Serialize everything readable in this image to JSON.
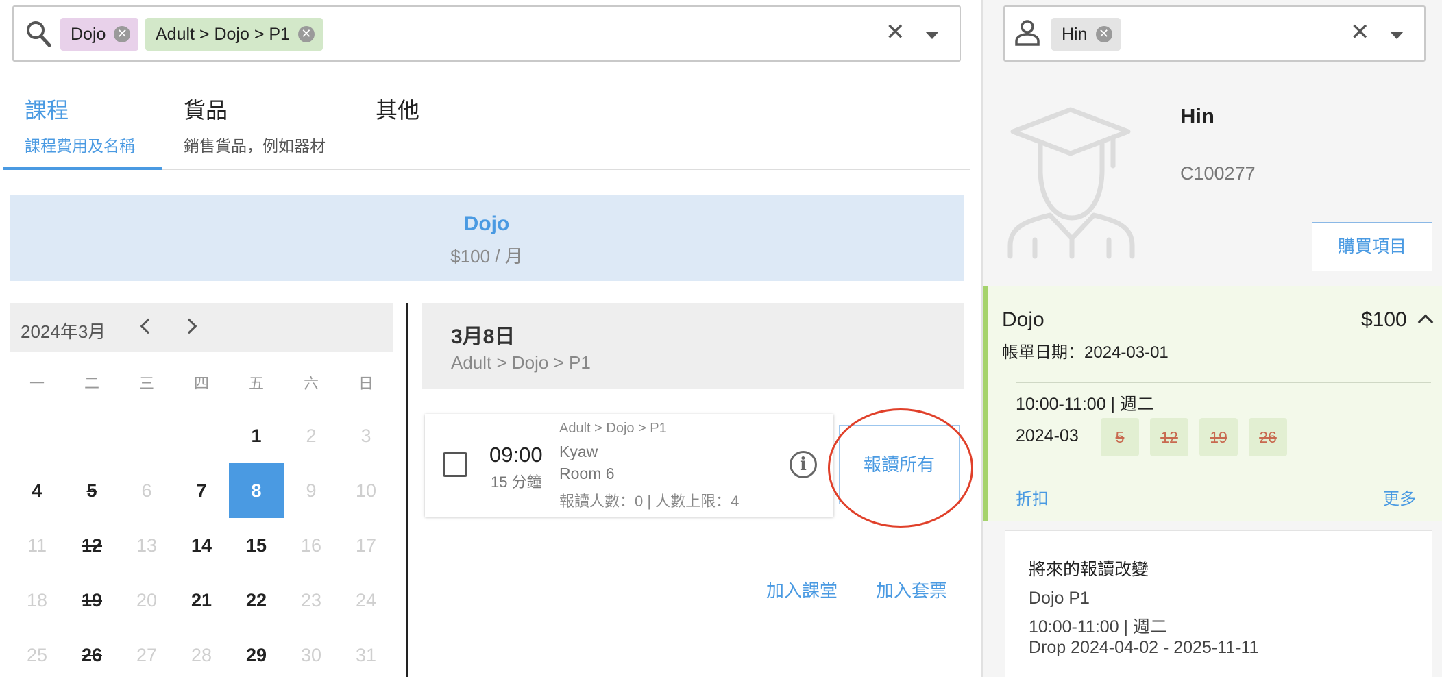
{
  "course_search": {
    "chips": [
      {
        "label": "Dojo"
      },
      {
        "label": "Adult > Dojo > P1"
      }
    ]
  },
  "tabs": [
    {
      "title": "課程",
      "subtitle": "課程費用及名稱",
      "active": true
    },
    {
      "title": "貨品",
      "subtitle": "銷售貨品，例如器材",
      "active": false
    },
    {
      "title": "其他",
      "subtitle": "",
      "active": false
    }
  ],
  "course_banner": {
    "name": "Dojo",
    "price": "$100 / 月"
  },
  "calendar": {
    "month_label": "2024年3月",
    "weekdays": [
      "一",
      "二",
      "三",
      "四",
      "五",
      "六",
      "日"
    ],
    "weeks": [
      [
        null,
        null,
        null,
        null,
        {
          "d": "1",
          "s": "on"
        },
        {
          "d": "2",
          "s": "off"
        },
        {
          "d": "3",
          "s": "off"
        }
      ],
      [
        {
          "d": "4",
          "s": "on"
        },
        {
          "d": "5",
          "s": "strike"
        },
        {
          "d": "6",
          "s": "off"
        },
        {
          "d": "7",
          "s": "on"
        },
        {
          "d": "8",
          "s": "sel"
        },
        {
          "d": "9",
          "s": "off"
        },
        {
          "d": "10",
          "s": "off"
        }
      ],
      [
        {
          "d": "11",
          "s": "off"
        },
        {
          "d": "12",
          "s": "strike"
        },
        {
          "d": "13",
          "s": "off"
        },
        {
          "d": "14",
          "s": "on"
        },
        {
          "d": "15",
          "s": "on"
        },
        {
          "d": "16",
          "s": "off"
        },
        {
          "d": "17",
          "s": "off"
        }
      ],
      [
        {
          "d": "18",
          "s": "off"
        },
        {
          "d": "19",
          "s": "strike"
        },
        {
          "d": "20",
          "s": "off"
        },
        {
          "d": "21",
          "s": "on"
        },
        {
          "d": "22",
          "s": "on"
        },
        {
          "d": "23",
          "s": "off"
        },
        {
          "d": "24",
          "s": "off"
        }
      ],
      [
        {
          "d": "25",
          "s": "off"
        },
        {
          "d": "26",
          "s": "strike"
        },
        {
          "d": "27",
          "s": "off"
        },
        {
          "d": "28",
          "s": "off"
        },
        {
          "d": "29",
          "s": "on"
        },
        {
          "d": "30",
          "s": "off"
        },
        {
          "d": "31",
          "s": "off"
        }
      ]
    ]
  },
  "day_detail": {
    "date_label": "3月8日",
    "course_path": "Adult > Dojo > P1",
    "lesson": {
      "time": "09:00",
      "duration": "15 分鐘",
      "path": "Adult > Dojo > P1",
      "coach": "Kyaw",
      "room": "Room 6",
      "capacity": "報讀人數：0 | 人數上限：4"
    },
    "enroll_all_label": "報讀所有",
    "add_class_label": "加入課堂",
    "add_package_label": "加入套票"
  },
  "student_search": {
    "chip": "Hin"
  },
  "student": {
    "name": "Hin",
    "id": "C100277",
    "buy_label": "購買項目"
  },
  "plan": {
    "name": "Dojo",
    "price": "$100",
    "bill_date": "帳單日期：2024-03-01",
    "slot": "10:00-11:00 | 週二",
    "month": "2024-03",
    "days": [
      "5",
      "12",
      "19",
      "26"
    ],
    "discount_label": "折扣",
    "more_label": "更多"
  },
  "future_changes": {
    "heading": "將來的報讀改變",
    "lines": [
      "Dojo P1",
      "10:00-11:00 | 週二",
      "Drop 2024-04-02 - 2025-11-11"
    ]
  },
  "colors": {
    "accent": "#4a9ae2",
    "highlight_circle": "#e0402a",
    "plan_bar": "#a5d36c"
  }
}
